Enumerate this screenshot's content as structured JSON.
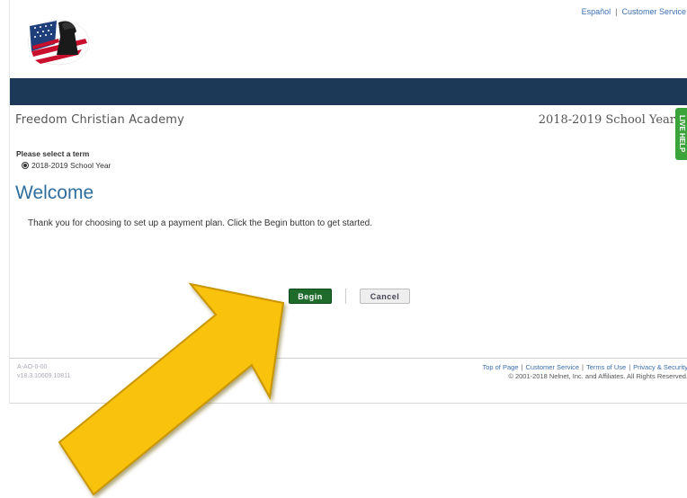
{
  "top_links": {
    "espanol": "Español",
    "customer_service": "Customer Service",
    "separator": "|"
  },
  "header": {
    "school_name": "Freedom Christian Academy",
    "school_year": "2018-2019 School Year",
    "side_tab": "LIVE HELP"
  },
  "term": {
    "label": "Please select a term",
    "option": "2018-2019 School Year"
  },
  "main": {
    "heading": "Welcome",
    "intro": "Thank you for choosing to set up a payment plan. Click the Begin button to get started."
  },
  "buttons": {
    "begin": "Begin",
    "cancel": "Cancel"
  },
  "footer": {
    "code_line1": "A-AO-0-00",
    "code_line2": "v18.3.10609.10811",
    "link_top": "Top of Page",
    "link_service": "Customer Service",
    "link_terms": "Terms of Use",
    "link_privacy": "Privacy & Security",
    "separator": "|",
    "copyright": "© 2001-2018 Nelnet, Inc. and Affiliates. All Rights Reserved."
  },
  "colors": {
    "navbar": "#1c3a57",
    "heading": "#2f6d9c",
    "begin_button": "#1f6b2b",
    "arrow": "#f8c20a"
  },
  "icons": {
    "logo": "flag-soldier-logo-icon",
    "arrow": "callout-arrow-icon"
  }
}
